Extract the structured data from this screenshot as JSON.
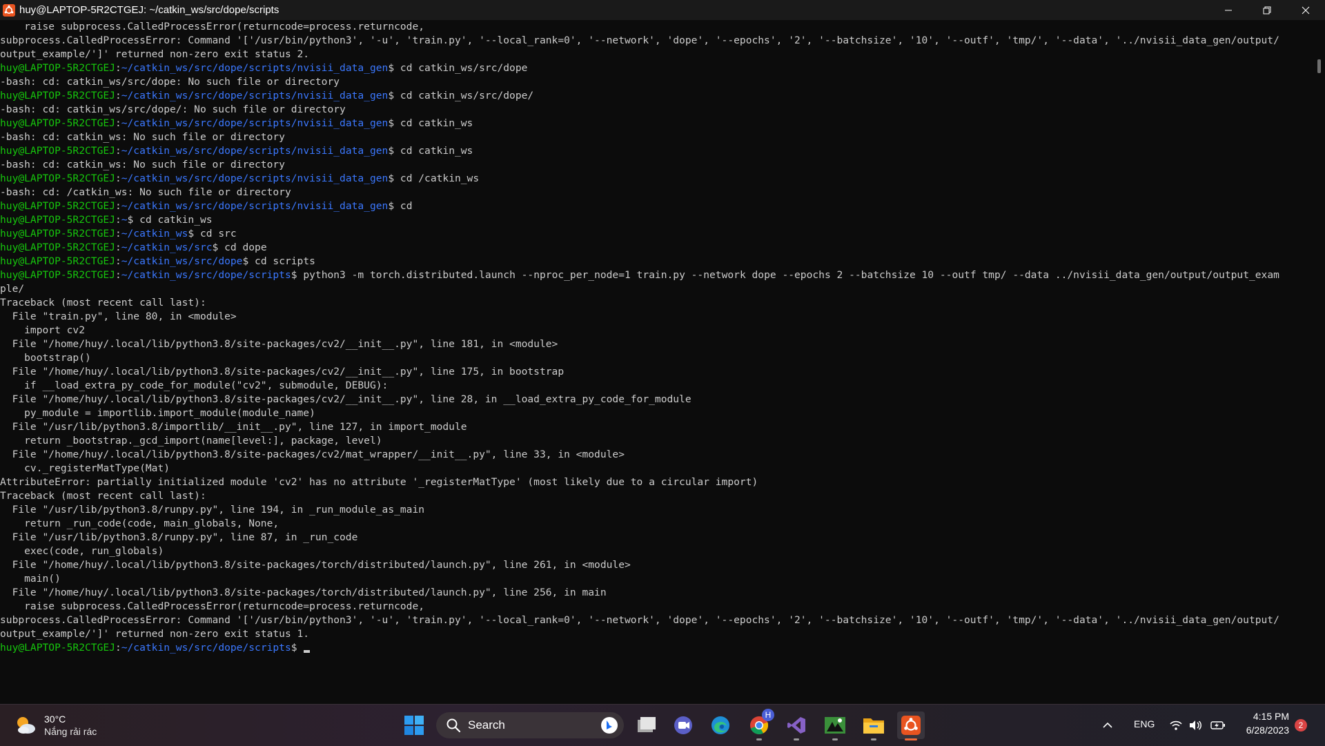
{
  "window": {
    "title": "huy@LAPTOP-5R2CTGEJ: ~/catkin_ws/src/dope/scripts"
  },
  "terminal": {
    "lines": [
      {
        "text": "    raise subprocess.CalledProcessError(returncode=process.returncode,"
      },
      {
        "text": "subprocess.CalledProcessError: Command '['/usr/bin/python3', '-u', 'train.py', '--local_rank=0', '--network', 'dope', '--epochs', '2', '--batchsize', '10', '--outf', 'tmp/', '--data', '../nvisii_data_gen/output/"
      },
      {
        "text": "output_example/']' returned non-zero exit status 2."
      },
      {
        "prompt": {
          "user": "huy@LAPTOP-5R2CTGEJ",
          "path": "~/catkin_ws/src/dope/scripts/nvisii_data_gen"
        },
        "text": " cd catkin_ws/src/dope"
      },
      {
        "text": "-bash: cd: catkin_ws/src/dope: No such file or directory"
      },
      {
        "prompt": {
          "user": "huy@LAPTOP-5R2CTGEJ",
          "path": "~/catkin_ws/src/dope/scripts/nvisii_data_gen"
        },
        "text": " cd catkin_ws/src/dope/"
      },
      {
        "text": "-bash: cd: catkin_ws/src/dope/: No such file or directory"
      },
      {
        "prompt": {
          "user": "huy@LAPTOP-5R2CTGEJ",
          "path": "~/catkin_ws/src/dope/scripts/nvisii_data_gen"
        },
        "text": " cd catkin_ws"
      },
      {
        "text": "-bash: cd: catkin_ws: No such file or directory"
      },
      {
        "prompt": {
          "user": "huy@LAPTOP-5R2CTGEJ",
          "path": "~/catkin_ws/src/dope/scripts/nvisii_data_gen"
        },
        "text": " cd catkin_ws"
      },
      {
        "text": "-bash: cd: catkin_ws: No such file or directory"
      },
      {
        "prompt": {
          "user": "huy@LAPTOP-5R2CTGEJ",
          "path": "~/catkin_ws/src/dope/scripts/nvisii_data_gen"
        },
        "text": " cd /catkin_ws"
      },
      {
        "text": "-bash: cd: /catkin_ws: No such file or directory"
      },
      {
        "prompt": {
          "user": "huy@LAPTOP-5R2CTGEJ",
          "path": "~/catkin_ws/src/dope/scripts/nvisii_data_gen"
        },
        "text": " cd"
      },
      {
        "prompt": {
          "user": "huy@LAPTOP-5R2CTGEJ",
          "path": "~"
        },
        "text": " cd catkin_ws"
      },
      {
        "prompt": {
          "user": "huy@LAPTOP-5R2CTGEJ",
          "path": "~/catkin_ws"
        },
        "text": " cd src"
      },
      {
        "prompt": {
          "user": "huy@LAPTOP-5R2CTGEJ",
          "path": "~/catkin_ws/src"
        },
        "text": " cd dope"
      },
      {
        "prompt": {
          "user": "huy@LAPTOP-5R2CTGEJ",
          "path": "~/catkin_ws/src/dope"
        },
        "text": " cd scripts"
      },
      {
        "prompt": {
          "user": "huy@LAPTOP-5R2CTGEJ",
          "path": "~/catkin_ws/src/dope/scripts"
        },
        "text": " python3 -m torch.distributed.launch --nproc_per_node=1 train.py --network dope --epochs 2 --batchsize 10 --outf tmp/ --data ../nvisii_data_gen/output/output_exam"
      },
      {
        "text": "ple/"
      },
      {
        "text": "Traceback (most recent call last):"
      },
      {
        "text": "  File \"train.py\", line 80, in <module>"
      },
      {
        "text": "    import cv2"
      },
      {
        "text": "  File \"/home/huy/.local/lib/python3.8/site-packages/cv2/__init__.py\", line 181, in <module>"
      },
      {
        "text": "    bootstrap()"
      },
      {
        "text": "  File \"/home/huy/.local/lib/python3.8/site-packages/cv2/__init__.py\", line 175, in bootstrap"
      },
      {
        "text": "    if __load_extra_py_code_for_module(\"cv2\", submodule, DEBUG):"
      },
      {
        "text": "  File \"/home/huy/.local/lib/python3.8/site-packages/cv2/__init__.py\", line 28, in __load_extra_py_code_for_module"
      },
      {
        "text": "    py_module = importlib.import_module(module_name)"
      },
      {
        "text": "  File \"/usr/lib/python3.8/importlib/__init__.py\", line 127, in import_module"
      },
      {
        "text": "    return _bootstrap._gcd_import(name[level:], package, level)"
      },
      {
        "text": "  File \"/home/huy/.local/lib/python3.8/site-packages/cv2/mat_wrapper/__init__.py\", line 33, in <module>"
      },
      {
        "text": "    cv._registerMatType(Mat)"
      },
      {
        "text": "AttributeError: partially initialized module 'cv2' has no attribute '_registerMatType' (most likely due to a circular import)"
      },
      {
        "text": "Traceback (most recent call last):"
      },
      {
        "text": "  File \"/usr/lib/python3.8/runpy.py\", line 194, in _run_module_as_main"
      },
      {
        "text": "    return _run_code(code, main_globals, None,"
      },
      {
        "text": "  File \"/usr/lib/python3.8/runpy.py\", line 87, in _run_code"
      },
      {
        "text": "    exec(code, run_globals)"
      },
      {
        "text": "  File \"/home/huy/.local/lib/python3.8/site-packages/torch/distributed/launch.py\", line 261, in <module>"
      },
      {
        "text": "    main()"
      },
      {
        "text": "  File \"/home/huy/.local/lib/python3.8/site-packages/torch/distributed/launch.py\", line 256, in main"
      },
      {
        "text": "    raise subprocess.CalledProcessError(returncode=process.returncode,"
      },
      {
        "text": "subprocess.CalledProcessError: Command '['/usr/bin/python3', '-u', 'train.py', '--local_rank=0', '--network', 'dope', '--epochs', '2', '--batchsize', '10', '--outf', 'tmp/', '--data', '../nvisii_data_gen/output/"
      },
      {
        "text": "output_example/']' returned non-zero exit status 1."
      },
      {
        "prompt": {
          "user": "huy@LAPTOP-5R2CTGEJ",
          "path": "~/catkin_ws/src/dope/scripts"
        },
        "text": " ",
        "cursor": true
      }
    ]
  },
  "taskbar": {
    "weather": {
      "temp": "30°C",
      "condition": "Nắng rải rác"
    },
    "search_label": "Search",
    "language": "ENG",
    "time": "4:15 PM",
    "date": "6/28/2023",
    "notification_count": "2",
    "chrome_badge": "H"
  },
  "colors": {
    "prompt_user": "#16c60c",
    "prompt_path": "#3b78ff",
    "terminal_text": "#cccccc",
    "terminal_bg": "#0c0c0c"
  }
}
